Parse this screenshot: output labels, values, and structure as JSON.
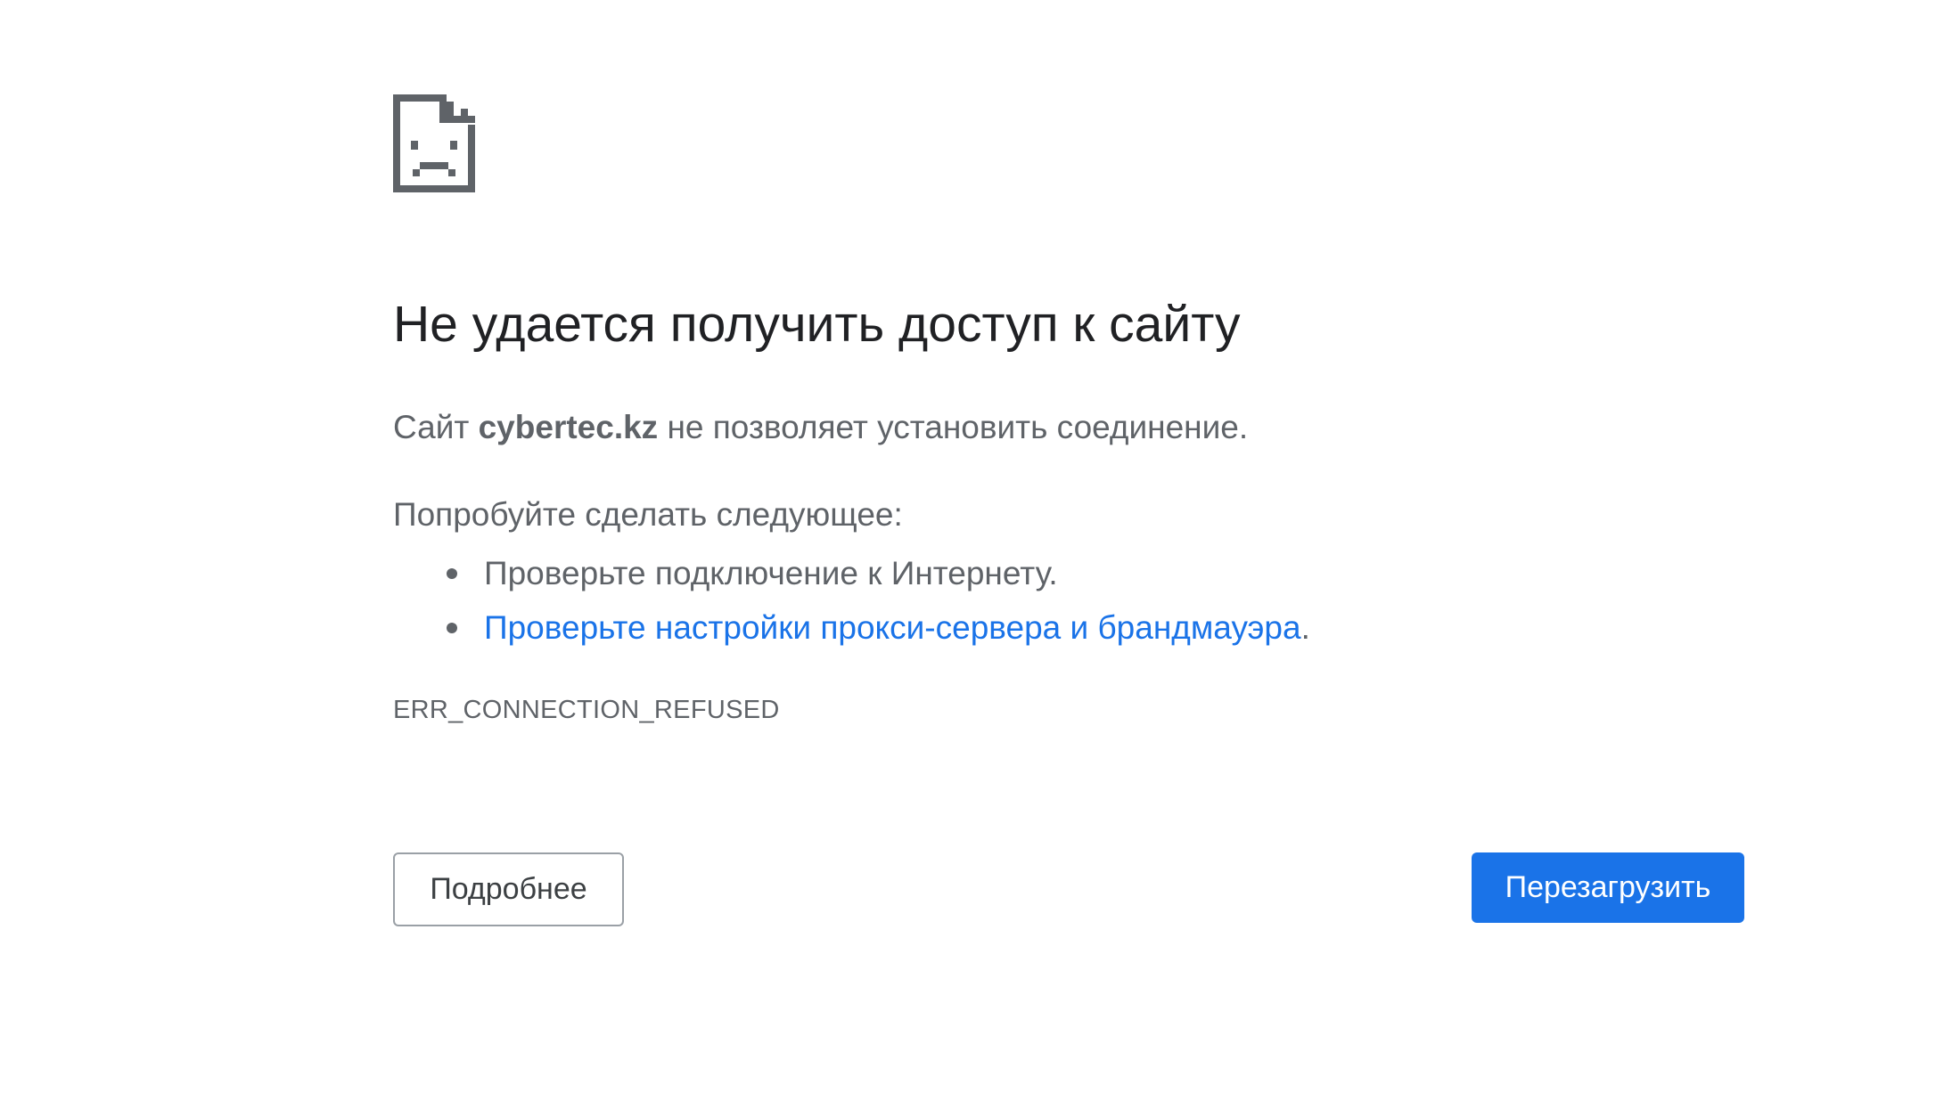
{
  "main": {
    "icon": "sad-page-icon",
    "title": "Не удается получить доступ к сайту",
    "summary": {
      "prefix": "Сайт ",
      "host": "cybertec.kz",
      "suffix": " не позволяет установить соединение."
    },
    "suggestions": {
      "heading": "Попробуйте сделать следующее:",
      "items": [
        {
          "text": "Проверьте подключение к Интернету."
        },
        {
          "link_text": "Проверьте настройки прокси-сервера и брандмауэра",
          "suffix": "."
        }
      ]
    },
    "error_code": "ERR_CONNECTION_REFUSED"
  },
  "buttons": {
    "details_label": "Подробнее",
    "reload_label": "Перезагрузить"
  },
  "colors": {
    "title": "#202124",
    "body_text": "#5f6368",
    "link": "#1a73e8",
    "primary_button": "#1a73e8",
    "icon": "#5f6368"
  }
}
